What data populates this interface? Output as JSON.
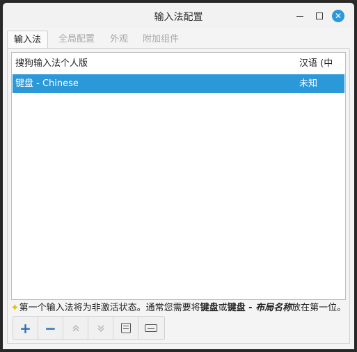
{
  "window": {
    "title": "输入法配置"
  },
  "tabs": [
    {
      "label": "输入法",
      "active": true
    },
    {
      "label": "全局配置",
      "active": false
    },
    {
      "label": "外观",
      "active": false
    },
    {
      "label": "附加组件",
      "active": false
    }
  ],
  "input_methods": [
    {
      "name": "搜狗输入法个人版",
      "language": "汉语 (中国)",
      "selected": false
    },
    {
      "name": "键盘 - Chinese",
      "language": "未知",
      "selected": true
    }
  ],
  "hint": {
    "icon": "star-icon",
    "part1": "第一个输入法将为非激活状态。通常您需要将",
    "bold1": "键盘",
    "part2": "或",
    "bold2": "键盘 - ",
    "italic": "布局名称",
    "part3": "放在第一位。"
  },
  "toolbar": {
    "add_icon": "plus-icon",
    "remove_icon": "minus-icon",
    "up_icon": "move-up-icon",
    "down_icon": "move-down-icon",
    "configure_icon": "configure-icon",
    "keyboard_icon": "keyboard-icon"
  },
  "colors": {
    "accent": "#2b98d8",
    "selected_text": "#ffffff"
  }
}
